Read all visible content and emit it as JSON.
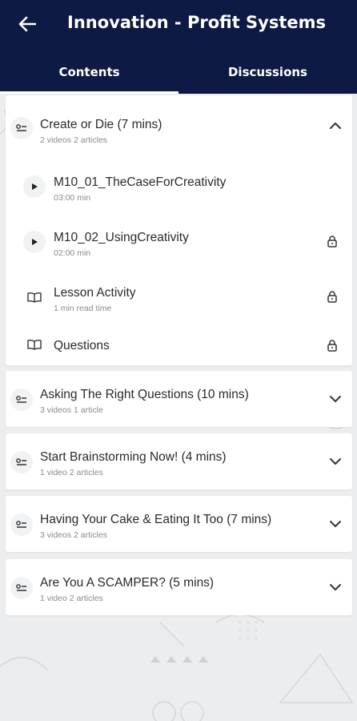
{
  "header": {
    "title": "Innovation - Profit Systems",
    "back_icon": "arrow-left-icon",
    "background_color": "#0d1a44"
  },
  "tabs": [
    {
      "label": "Contents",
      "active": true
    },
    {
      "label": "Discussions",
      "active": false
    }
  ],
  "sections": [
    {
      "title": "Create or Die (7 mins)",
      "subtitle": "2 videos 2 articles",
      "expanded": true,
      "icon": "module-list-icon",
      "lessons": [
        {
          "title": "M10_01_TheCaseForCreativity",
          "meta": "03:00 min",
          "type": "video",
          "icon": "play-icon",
          "locked": false
        },
        {
          "title": "M10_02_UsingCreativity",
          "meta": "02:00 min",
          "type": "video",
          "icon": "play-icon",
          "locked": true
        },
        {
          "title": "Lesson Activity",
          "meta": "1 min read time",
          "type": "article",
          "icon": "book-icon",
          "locked": true
        },
        {
          "title": "Questions",
          "meta": "",
          "type": "article",
          "icon": "book-icon",
          "locked": true
        }
      ]
    },
    {
      "title": "Asking The Right Questions (10 mins)",
      "subtitle": "3 videos 1 article",
      "expanded": false,
      "icon": "module-list-icon"
    },
    {
      "title": "Start Brainstorming Now! (4 mins)",
      "subtitle": "1 video 2 articles",
      "expanded": false,
      "icon": "module-list-icon"
    },
    {
      "title": "Having Your Cake & Eating It Too (7 mins)",
      "subtitle": "3 videos 2 articles",
      "expanded": false,
      "icon": "module-list-icon"
    },
    {
      "title": "Are You A SCAMPER? (5 mins)",
      "subtitle": "1 video 2 articles",
      "expanded": false,
      "icon": "module-list-icon"
    }
  ]
}
